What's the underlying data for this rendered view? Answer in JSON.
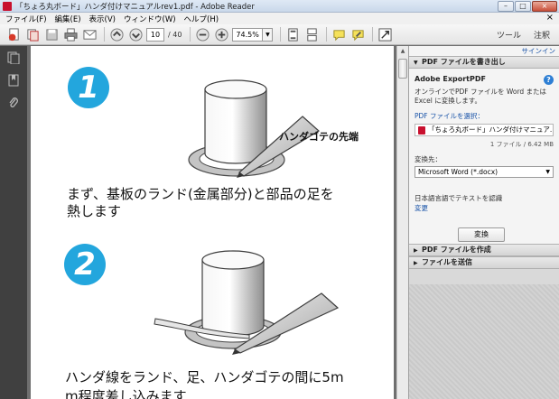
{
  "window": {
    "title": "「ちょろ丸ボード」ハンダ付けマニュアルrev1.pdf - Adobe Reader",
    "buttons": {
      "minimize": "–",
      "maximize": "□",
      "close": "×"
    }
  },
  "menu": {
    "items": [
      "ファイル(F)",
      "編集(E)",
      "表示(V)",
      "ウィンドウ(W)",
      "ヘルプ(H)"
    ],
    "close": "×"
  },
  "toolbar": {
    "page_current": "10",
    "page_count": "/ 40",
    "zoom": "74.5%",
    "tools_label": "ツール",
    "comment_label": "注釈"
  },
  "document": {
    "step1": {
      "number": "1",
      "tip_label": "ハンダゴテの先端",
      "text_line1": "まず、基板のランド(金属部分)と部品の足を",
      "text_line2": "熱します"
    },
    "step2": {
      "number": "2",
      "text_line1": "ハンダ線をランド、足、ハンダゴテの間に5m",
      "text_line2": "m程度差し込みます"
    }
  },
  "right_panel": {
    "signin": "サインイン",
    "export_header": "PDF ファイルを書き出し",
    "export_title": "Adobe ExportPDF",
    "export_desc": "オンラインでPDF ファイルを Word または Excel に変換します。",
    "select_pdf_link": "PDF ファイルを選択：",
    "selected_file": "「ちょろ丸ボード」ハンダ付けマニュア...",
    "file_count": "1 ファイル / 6.42 MB",
    "convert_to_label": "変換先：",
    "convert_to_value": "Microsoft Word (*.docx)",
    "ocr_label": "日本語言語でテキストを認識",
    "ocr_change": "変更",
    "convert_button": "変換",
    "create_header": "PDF ファイルを作成",
    "send_header": "ファイルを送信"
  }
}
